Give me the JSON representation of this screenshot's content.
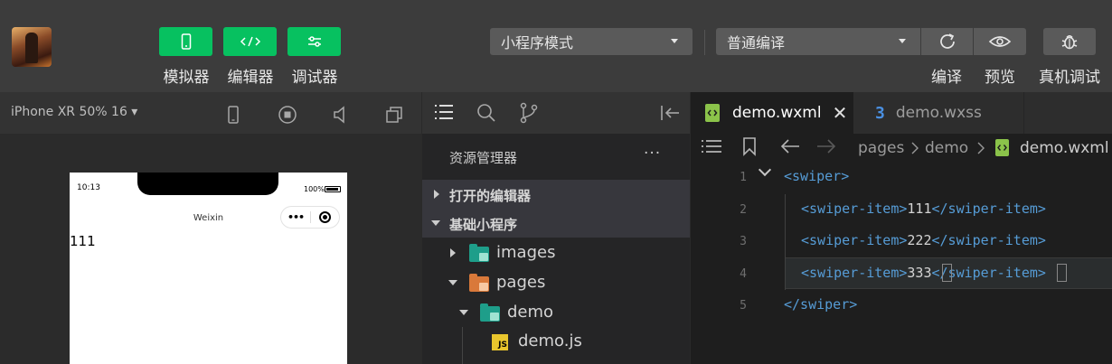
{
  "toolbar": {
    "buttons": [
      {
        "label": "模拟器",
        "icon": "phone-icon"
      },
      {
        "label": "编辑器",
        "icon": "code-icon"
      },
      {
        "label": "调试器",
        "icon": "sliders-icon"
      }
    ],
    "mode_select": "小程序模式",
    "compile_select": "普通编译",
    "right_actions": [
      {
        "label": "编译",
        "icon": "refresh-icon"
      },
      {
        "label": "预览",
        "icon": "eye-icon"
      },
      {
        "label": "真机调试",
        "icon": "bug-icon"
      }
    ],
    "accent_color": "#07c160"
  },
  "simulator": {
    "device": "iPhone XR 50% 16 ▾",
    "status_time": "10:13",
    "status_battery": "100%",
    "nav_title": "Weixin",
    "capsule_dots": "•••",
    "page_text": "111"
  },
  "explorer": {
    "title": "资源管理器",
    "more": "···",
    "sections": [
      {
        "label": "打开的编辑器",
        "expanded": false
      },
      {
        "label": "基础小程序",
        "expanded": true
      }
    ],
    "tree": [
      {
        "label": "images",
        "type": "folder",
        "expanded": false,
        "color": "#1e9e8a"
      },
      {
        "label": "pages",
        "type": "folder",
        "expanded": true,
        "color": "#d9793a"
      },
      {
        "label": "demo",
        "type": "folder",
        "expanded": true,
        "color": "#1e9e8a"
      },
      {
        "label": "demo.js",
        "type": "file-js"
      }
    ]
  },
  "editor": {
    "tabs": [
      {
        "label": "demo.wxml",
        "active": true
      },
      {
        "label": "demo.wxss",
        "active": false
      }
    ],
    "breadcrumb": [
      "pages",
      "demo",
      "demo.wxml"
    ],
    "lines": [
      {
        "num": "1",
        "parts": [
          {
            "t": "tag",
            "v": "<swiper>"
          }
        ]
      },
      {
        "num": "2",
        "parts": [
          {
            "t": "tag",
            "v": "<swiper-item>"
          },
          {
            "t": "txt",
            "v": "111"
          },
          {
            "t": "tag",
            "v": "</swiper-item>"
          }
        ]
      },
      {
        "num": "3",
        "parts": [
          {
            "t": "tag",
            "v": "<swiper-item>"
          },
          {
            "t": "txt",
            "v": "222"
          },
          {
            "t": "tag",
            "v": "</swiper-item>"
          }
        ]
      },
      {
        "num": "4",
        "parts": [
          {
            "t": "tag",
            "v": "<swiper-item>"
          },
          {
            "t": "txt",
            "v": "333"
          },
          {
            "t": "tag",
            "v": "</swiper-item>"
          }
        ]
      },
      {
        "num": "5",
        "parts": [
          {
            "t": "tag",
            "v": "</swiper>"
          }
        ]
      }
    ]
  }
}
